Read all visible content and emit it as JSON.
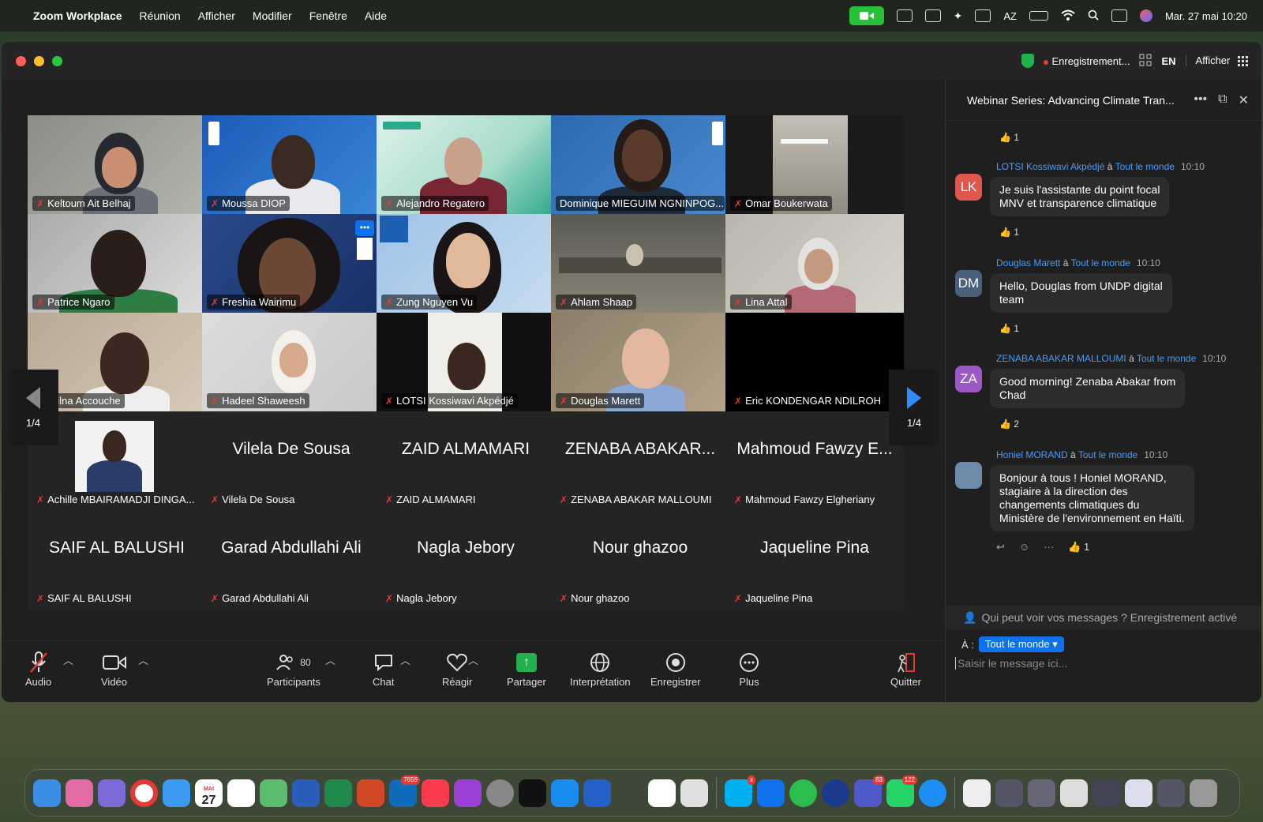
{
  "menubar": {
    "app": "Zoom Workplace",
    "items": [
      "Réunion",
      "Afficher",
      "Modifier",
      "Fenêtre",
      "Aide"
    ],
    "keyboard": "AZ",
    "datetime": "Mar. 27 mai  10:20"
  },
  "titlebar": {
    "recording": "Enregistrement...",
    "language": "EN",
    "view": "Afficher"
  },
  "gallery": {
    "page_left": "1/4",
    "page_right": "1/4",
    "tiles": [
      {
        "name": "Keltoum Ait Belhaj"
      },
      {
        "name": "Moussa DIOP"
      },
      {
        "name": "Alejandro Regatero"
      },
      {
        "name": "Dominique MIEGUIM NGNINPOG..."
      },
      {
        "name": "Omar Boukerwata"
      },
      {
        "name": "Patrice Ngaro"
      },
      {
        "name": "Freshia Wairimu"
      },
      {
        "name": "Zung Nguyen Vu"
      },
      {
        "name": "Ahlam Shaap"
      },
      {
        "name": "Lina Attal"
      },
      {
        "name": "Wilna Accouche"
      },
      {
        "name": "Hadeel Shaweesh"
      },
      {
        "name": "LOTSI Kossiwavi Akpédjé"
      },
      {
        "name": "Douglas Marett"
      },
      {
        "name": "Eric KONDENGAR NDILROH"
      },
      {
        "name": "Achille MBAIRAMADJI DINGA..."
      },
      {
        "name": "Vilela De Sousa",
        "big": "Vilela De Sousa"
      },
      {
        "name": "ZAID ALMAMARI",
        "big": "ZAID ALMAMARI"
      },
      {
        "name": "ZENABA ABAKAR MALLOUMI",
        "big": "ZENABA ABAKAR..."
      },
      {
        "name": "Mahmoud Fawzy Elgheriany",
        "big": "Mahmoud Fawzy E..."
      },
      {
        "name": "SAIF AL BALUSHI",
        "big": "SAIF AL BALUSHI"
      },
      {
        "name": "Garad Abdullahi Ali",
        "big": "Garad Abdullahi Ali"
      },
      {
        "name": "Nagla Jebory",
        "big": "Nagla Jebory"
      },
      {
        "name": "Nour ghazoo",
        "big": "Nour ghazoo"
      },
      {
        "name": "Jaqueline Pina",
        "big": "Jaqueline Pina"
      }
    ]
  },
  "toolbar": {
    "audio": "Audio",
    "video": "Vidéo",
    "participants": "Participants",
    "participants_count": "80",
    "chat": "Chat",
    "react": "Réagir",
    "share": "Partager",
    "interpretation": "Interprétation",
    "record": "Enregistrer",
    "more": "Plus",
    "quit": "Quitter"
  },
  "chat": {
    "title": "Webinar Series: Advancing Climate Tran...",
    "top_reaction": "1",
    "messages": [
      {
        "initials": "LK",
        "sender": "LOTSI Kossiwavi Akpédjé",
        "to": "à",
        "recipient": "Tout le monde",
        "time": "10:10",
        "line1": "Je suis l'assistante du point focal",
        "line2": "MNV et transparence climatique",
        "reaction": "1",
        "color": "#e0574f"
      },
      {
        "initials": "DM",
        "sender": "Douglas Marett",
        "to": "à",
        "recipient": "Tout le monde",
        "time": "10:10",
        "line1": "Hello, Douglas from UNDP digital",
        "line2": "team",
        "reaction": "1",
        "color": "#4a5f7a"
      },
      {
        "initials": "ZA",
        "sender": "ZENABA ABAKAR MALLOUMI",
        "to": "à",
        "recipient": "Tout le monde",
        "time": "10:10",
        "line1": "Good morning! Zenaba Abakar from",
        "line2": "Chad",
        "reaction": "2",
        "color": "#9b59c6"
      },
      {
        "initials": "",
        "sender": "Honiel MORAND",
        "to": "à",
        "recipient": "Tout le monde",
        "time": "10:10",
        "line1": "Bonjour à tous ! Honiel MORAND,",
        "line2": "stagiaire à la direction des",
        "line3": "changements climatiques du",
        "line4": "Ministère de l'environnement en Haïti.",
        "reaction": "1",
        "color": "#6f89a8"
      }
    ],
    "notice": "Qui peut voir vos messages ? Enregistrement activé",
    "to_label": "À :",
    "to_value": "Tout le monde",
    "placeholder": "Saisir le message ici..."
  },
  "dock": {
    "calendar_month": "MAI",
    "calendar_day": "27",
    "badges": {
      "outlook": "7659",
      "skype": "x",
      "teams": "83",
      "whatsapp": "122"
    }
  }
}
